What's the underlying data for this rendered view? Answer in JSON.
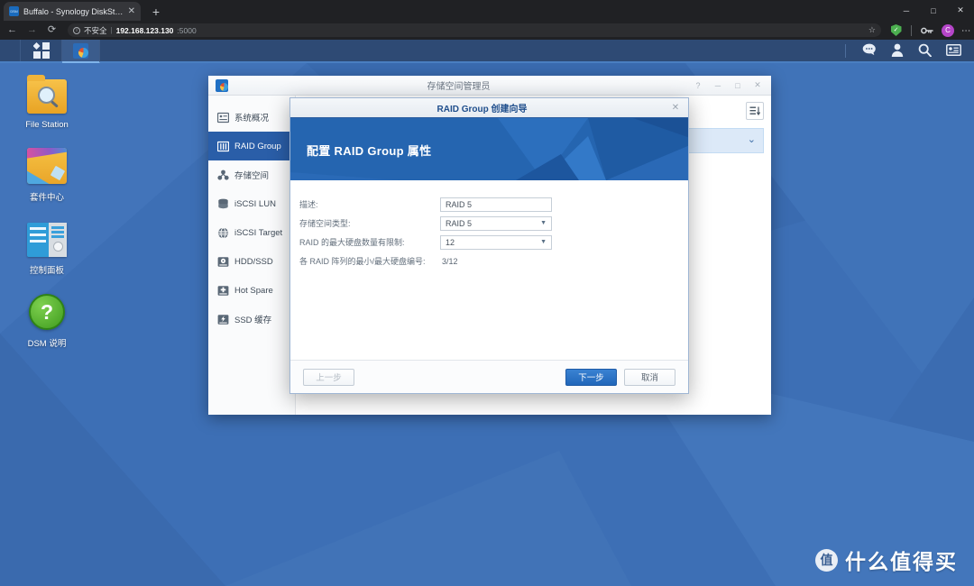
{
  "browser": {
    "tab": {
      "title": "Buffalo - Synology DiskStation",
      "favicon_label": "DSM",
      "close_icon": "✕"
    },
    "new_tab_icon": "+",
    "window_controls": {
      "minimize": "─",
      "maximize": "□",
      "close": "✕"
    },
    "nav": {
      "back": "←",
      "forward": "→",
      "reload": "⟳"
    },
    "omnibox": {
      "info_icon": "ⓘ",
      "security_label": "不安全",
      "separator": "|",
      "host": "192.168.123.130",
      "port": ":5000",
      "star_icon": "☆"
    },
    "extensions": [
      {
        "name": "shield-extension-icon",
        "glyph": "✓",
        "color": "#4caf50"
      },
      {
        "name": "key-extension-icon",
        "glyph": "⚷"
      }
    ],
    "profile": {
      "initial": "C",
      "color": "#b545c9"
    },
    "menu_icon": "⋮"
  },
  "dsm_taskbar": {
    "main_menu_name": "main-menu",
    "open_app": "存储空间管理员",
    "tray": [
      {
        "name": "chat-icon",
        "glyph": "💬"
      },
      {
        "name": "user-icon",
        "glyph": "👤"
      },
      {
        "name": "search-icon",
        "glyph": "🔍"
      },
      {
        "name": "notification-icon",
        "glyph": "📇"
      }
    ]
  },
  "desktop": {
    "icons": [
      {
        "label": "File Station",
        "name": "file-station"
      },
      {
        "label": "套件中心",
        "name": "package-center"
      },
      {
        "label": "控制面板",
        "name": "control-panel"
      },
      {
        "label": "DSM 说明",
        "name": "dsm-help",
        "glyph": "?"
      }
    ]
  },
  "storage_manager": {
    "title": "存储空间管理员",
    "controls": {
      "help": "?",
      "minimize": "─",
      "maximize": "□",
      "close": "✕"
    },
    "sidebar": [
      {
        "label": "系统概况",
        "name": "system-overview",
        "icon": "info-card-icon",
        "active": false
      },
      {
        "label": "RAID Group",
        "name": "raid-group",
        "icon": "raid-group-icon",
        "active": true
      },
      {
        "label": "存储空间",
        "name": "storage-volume",
        "icon": "volume-icon",
        "active": false
      },
      {
        "label": "iSCSI LUN",
        "name": "iscsi-lun",
        "icon": "lun-stack-icon",
        "active": false
      },
      {
        "label": "iSCSI Target",
        "name": "iscsi-target",
        "icon": "globe-icon",
        "active": false
      },
      {
        "label": "HDD/SSD",
        "name": "hdd-ssd",
        "icon": "disk-icon",
        "active": false
      },
      {
        "label": "Hot Spare",
        "name": "hot-spare",
        "icon": "plus-disk-icon",
        "active": false
      },
      {
        "label": "SSD 缓存",
        "name": "ssd-cache",
        "icon": "bolt-disk-icon",
        "active": false
      }
    ],
    "toolbar_icon": "sort-list-icon",
    "row_chevron": "⌄"
  },
  "dialog": {
    "title": "RAID Group 创建向导",
    "close_icon": "✕",
    "banner_heading": "配置 RAID Group 属性",
    "fields": [
      {
        "label": "描述:",
        "name": "description-field",
        "type": "text",
        "value": "RAID 5"
      },
      {
        "label": "存储空间类型:",
        "name": "volume-type-select",
        "type": "select",
        "value": "RAID 5",
        "caret": "▼"
      },
      {
        "label": "RAID 的最大硬盘数量有限制:",
        "name": "max-disk-count-select",
        "type": "select",
        "value": "12",
        "caret": "▼"
      },
      {
        "label": "各 RAID 阵列的最小/最大硬盘编号:",
        "name": "min-max-disk-range",
        "type": "static",
        "value": "3/12"
      }
    ],
    "buttons": {
      "back": {
        "label": "上一步",
        "disabled": true
      },
      "next": {
        "label": "下一步",
        "primary": true
      },
      "cancel": {
        "label": "取消",
        "disabled": false
      }
    }
  },
  "watermark": {
    "logo": "值",
    "text": "什么值得买"
  },
  "colors": {
    "desktop_blue": "#3d6fb5",
    "accent_blue": "#2a5ea8",
    "primary_button": "#2167ba",
    "taskbar": "#2e4a74",
    "browser_dark": "#202124"
  }
}
